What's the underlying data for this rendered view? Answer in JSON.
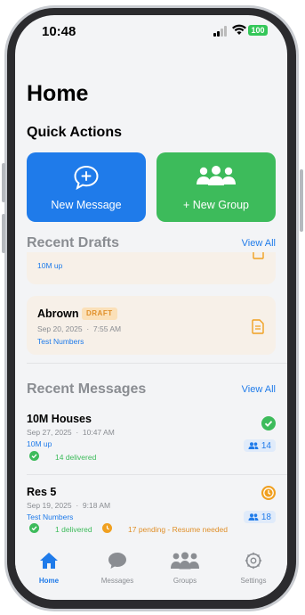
{
  "status": {
    "time": "10:48",
    "battery": "100"
  },
  "title": "Home",
  "quick_actions": {
    "title": "Quick Actions",
    "new_message": "New Message",
    "new_group": "+ New Group"
  },
  "drafts": {
    "title": "Recent Drafts",
    "view_all": "View All",
    "partial_group": "10M up",
    "items": [
      {
        "name": "Abrown",
        "badge": "DRAFT",
        "date": "Sep 20, 2025",
        "dot": "·",
        "time": "7:55 AM",
        "group": "Test Numbers"
      }
    ]
  },
  "messages": {
    "title": "Recent Messages",
    "view_all": "View All",
    "items": [
      {
        "name": "10M Houses",
        "date": "Sep 27, 2025",
        "dot": "·",
        "time": "10:47 AM",
        "group": "10M up",
        "delivered": "14 delivered",
        "count": "14"
      },
      {
        "name": "Res 5",
        "date": "Sep 19, 2025",
        "dot": "·",
        "time": "9:18 AM",
        "group": "Test Numbers",
        "delivered": "1 delivered",
        "pending": "17 pending - Resume needed",
        "count": "18"
      }
    ]
  },
  "tabs": [
    {
      "label": "Home",
      "icon": "home-icon",
      "active": true
    },
    {
      "label": "Messages",
      "icon": "chat-bubble-icon",
      "active": false
    },
    {
      "label": "Groups",
      "icon": "groups-icon",
      "active": false
    },
    {
      "label": "Settings",
      "icon": "gear-icon",
      "active": false
    }
  ],
  "colors": {
    "accent": "#1f7bea",
    "green": "#3dbb5b",
    "orange": "#f0a020",
    "draft_bg": "#f7f0e8"
  }
}
